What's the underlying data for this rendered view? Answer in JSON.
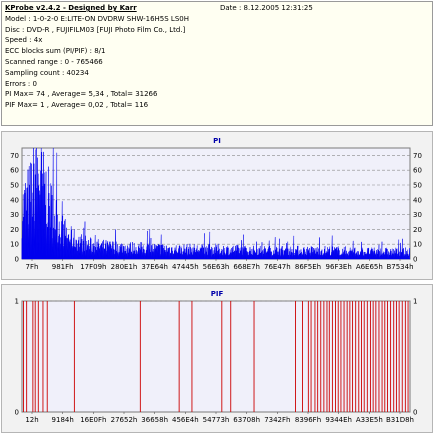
{
  "info": {
    "title": "KProbe v2.4.2 - Designed by Karr",
    "date": "Date : 8.12.2005 12:31:25",
    "lines": [
      "Model : 1-0-2-0 E:LITE-ON DVDRW SHW-16H5S  LS0H",
      "Disc : DVD-R , FUJIFILM03 [FUJI Photo Film Co., Ltd.]",
      "Speed : 4x",
      "ECC blocks sum (PI/PIF) : 8/1",
      "Scanned range : 0 - 765466",
      "Sampling count : 40234",
      "Errors : 0",
      "PI Max= 74 , Average= 5,34 , Total= 31266",
      "PIF Max= 1 , Average= 0,02 , Total= 116"
    ]
  },
  "colors": {
    "pi_fill": "#0000ee",
    "pif_line": "#cc0000",
    "plot_bg": "#f0f0fa",
    "panel_bg": "#f2f2f2",
    "grid": "#8a8a8a",
    "title": "#0000aa"
  },
  "chart_data": [
    {
      "type": "area",
      "title": "PI",
      "ylim": [
        0,
        75
      ],
      "yticks": [
        "0",
        "10",
        "20",
        "30",
        "40",
        "50",
        "60",
        "70"
      ],
      "yticks_right": [
        "0",
        "10",
        "20",
        "30",
        "40",
        "50",
        "60",
        "70"
      ],
      "xticks": [
        "7Fh",
        "981Fh",
        "17F09h",
        "280E1h",
        "37E64h",
        "47445h",
        "56E63h",
        "668E7h",
        "76E47h",
        "86F5Eh",
        "96F3Eh",
        "A6E65h",
        "B7534h"
      ],
      "grid": "dashed horizontal",
      "max": 74,
      "average": 5.34,
      "profile": [
        {
          "x": 0.0,
          "y": 40
        },
        {
          "x": 0.02,
          "y": 52
        },
        {
          "x": 0.04,
          "y": 70
        },
        {
          "x": 0.06,
          "y": 55
        },
        {
          "x": 0.08,
          "y": 38
        },
        {
          "x": 0.1,
          "y": 26
        },
        {
          "x": 0.12,
          "y": 18
        },
        {
          "x": 0.15,
          "y": 14
        },
        {
          "x": 0.18,
          "y": 11
        },
        {
          "x": 0.22,
          "y": 10
        },
        {
          "x": 0.3,
          "y": 9
        },
        {
          "x": 0.4,
          "y": 8
        },
        {
          "x": 0.5,
          "y": 8
        },
        {
          "x": 0.6,
          "y": 7
        },
        {
          "x": 0.7,
          "y": 7
        },
        {
          "x": 0.8,
          "y": 7
        },
        {
          "x": 0.9,
          "y": 6
        },
        {
          "x": 1.0,
          "y": 6
        }
      ]
    },
    {
      "type": "bar",
      "title": "PIF",
      "ylim": [
        0,
        1
      ],
      "yticks": [
        "0",
        "1"
      ],
      "yticks_right": [
        "0",
        "1"
      ],
      "xticks": [
        "12h",
        "9184h",
        "16E0Fh",
        "27652h",
        "36658h",
        "456E4h",
        "54773h",
        "63708h",
        "7342Fh",
        "8396Fh",
        "9344Eh",
        "A33E5h",
        "B31D8h"
      ],
      "grid": "dashed horizontal",
      "max": 1,
      "error_positions": [
        0.004,
        0.012,
        0.028,
        0.034,
        0.042,
        0.054,
        0.065,
        0.135,
        0.305,
        0.405,
        0.438,
        0.515,
        0.538,
        0.598,
        0.705,
        0.723,
        0.738,
        0.745,
        0.755,
        0.762,
        0.77,
        0.778,
        0.786,
        0.792,
        0.8,
        0.808,
        0.815,
        0.822,
        0.83,
        0.838,
        0.845,
        0.852,
        0.86,
        0.868,
        0.875,
        0.882,
        0.89,
        0.898,
        0.905,
        0.912,
        0.92,
        0.928,
        0.935,
        0.942,
        0.95,
        0.958,
        0.965,
        0.972,
        0.98,
        0.988,
        0.995
      ]
    }
  ]
}
